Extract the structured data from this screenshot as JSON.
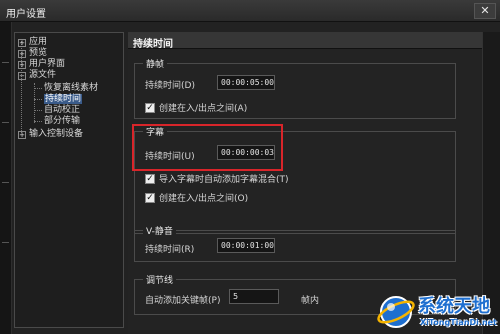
{
  "window": {
    "title": "用户设置",
    "close_glyph": "✕"
  },
  "tree": {
    "items": [
      {
        "label": "应用",
        "expander": "+"
      },
      {
        "label": "预览",
        "expander": "+"
      },
      {
        "label": "用户界面",
        "expander": "+"
      },
      {
        "label": "源文件",
        "expander": "−"
      },
      {
        "label": "恢复离线素材"
      },
      {
        "label": "持续时间",
        "selected": true
      },
      {
        "label": "自动校正"
      },
      {
        "label": "部分传输"
      },
      {
        "label": "输入控制设备",
        "expander": "+"
      }
    ]
  },
  "panel": {
    "title": "持续时间",
    "still": {
      "label": "静帧",
      "duration_label": "持续时间(D)",
      "duration_value": "00:00:05:00",
      "checkbox_label": "创建在入/出点之间(A)",
      "checked": true
    },
    "subtitle": {
      "label": "字幕",
      "duration_label": "持续时间(U)",
      "duration_value": "00:00:00:03",
      "checkbox1_label": "导入字幕时自动添加字幕混合(T)",
      "checkbox2_label": "创建在入/出点之间(O)",
      "checked1": true,
      "checked2": true
    },
    "mute": {
      "label": "V-静音",
      "duration_label": "持续时间(R)",
      "duration_value": "00:00:01:00"
    },
    "rubberband": {
      "label": "调节线",
      "keyframe_label": "自动添加关键帧(P)",
      "keyframe_value": "5",
      "unit": "帧内"
    }
  },
  "watermark": {
    "name": "系统天地",
    "url": "XiTongTianDi.net"
  },
  "colors": {
    "highlight": "#d9252a",
    "brand": "#1e6fd0",
    "selection": "#3a5b8a"
  }
}
